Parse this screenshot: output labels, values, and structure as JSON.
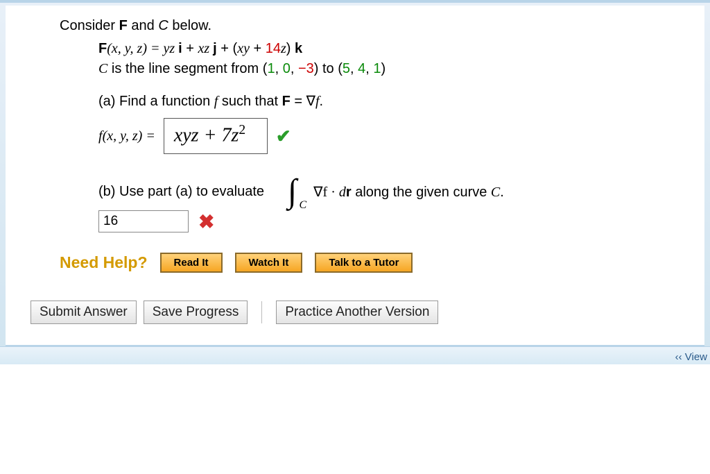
{
  "intro": {
    "consider_prefix": "Consider ",
    "F": "F",
    "and": " and ",
    "C": "C",
    "below": " below."
  },
  "formula": {
    "lhs_F": "F",
    "lhs_args": "(x, y, z) = ",
    "t1": "yz ",
    "i": "i",
    "plus1": " + ",
    "t2": "xz ",
    "j": "j",
    "plus2": " + (",
    "t3": "xy",
    "plus3": " + ",
    "coef": "14",
    "t4": "z",
    "close": ") ",
    "k": "k"
  },
  "curve": {
    "prefix": "C",
    "text1": " is the line segment from (",
    "p1a": "1",
    "c1": ", ",
    "p1b": "0",
    "c2": ", ",
    "p1c": "−3",
    "text2": ") to (",
    "p2a": "5",
    "c3": ", ",
    "p2b": "4",
    "c4": ", ",
    "p2c": "1",
    "text3": ")"
  },
  "part_a": {
    "label": "(a) Find a function ",
    "f": "f",
    "mid": " such that ",
    "F": "F",
    "eq": " = ∇",
    "f2": "f",
    "dot": "."
  },
  "answer_a": {
    "lhs_f": "f",
    "lhs_args": "(x, y, z) = ",
    "value_main": "xyz + 7z",
    "value_exp": "2"
  },
  "part_b": {
    "label": "(b) Use part (a) to evaluate",
    "int_sub": "C",
    "grad": "∇f",
    "dot": " · ",
    "d": "d",
    "r": "r",
    "after": "  along the given curve ",
    "Cfinal": "C",
    "dotend": "."
  },
  "answer_b": {
    "value": "16"
  },
  "help": {
    "label": "Need Help?",
    "read": "Read It",
    "watch": "Watch It",
    "tutor": "Talk to a Tutor"
  },
  "buttons": {
    "submit": "Submit Answer",
    "save": "Save Progress",
    "practice": "Practice Another Version"
  },
  "footer_link": "‹‹ View"
}
